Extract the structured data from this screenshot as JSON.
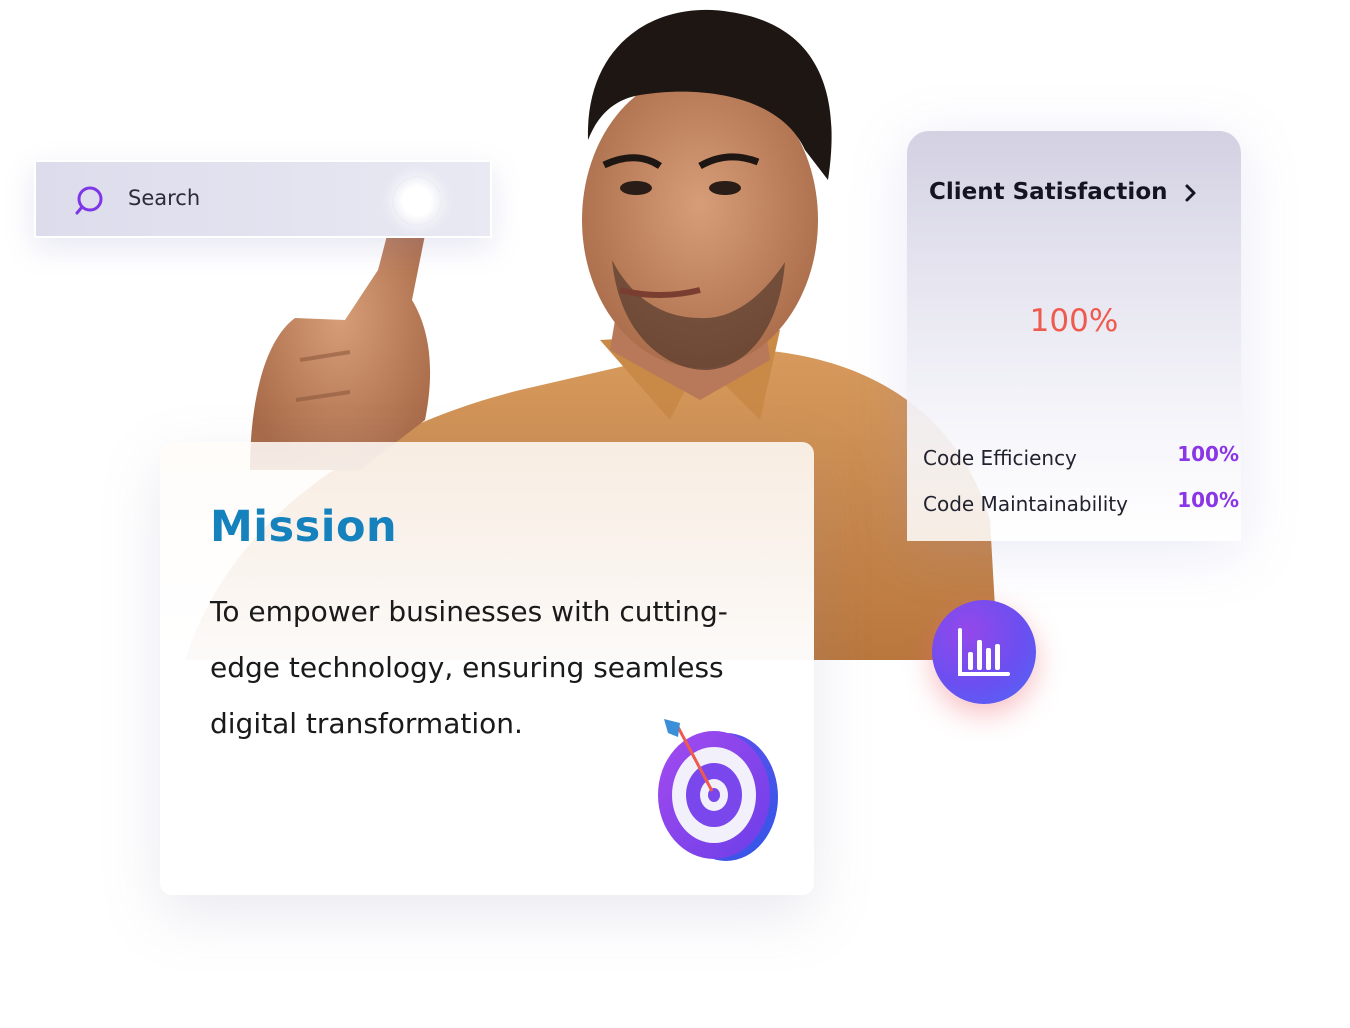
{
  "search": {
    "label": "Search",
    "icon": "search-icon"
  },
  "stats": {
    "title": "Client Satisfaction",
    "main_value": "100%",
    "metrics": [
      {
        "label": "Code Efficiency",
        "value": "100%"
      },
      {
        "label": "Code Maintainability",
        "value": "100%"
      }
    ],
    "accent_color": "#ef5a4e",
    "metric_color": "#8a35e6",
    "button_icon": "bar-chart-icon"
  },
  "mission": {
    "title": "Mission",
    "text": "To empower businesses with cutting-edge technology, ensuring seamless digital transformation.",
    "title_color": "#1582bd",
    "icon": "target-icon"
  }
}
